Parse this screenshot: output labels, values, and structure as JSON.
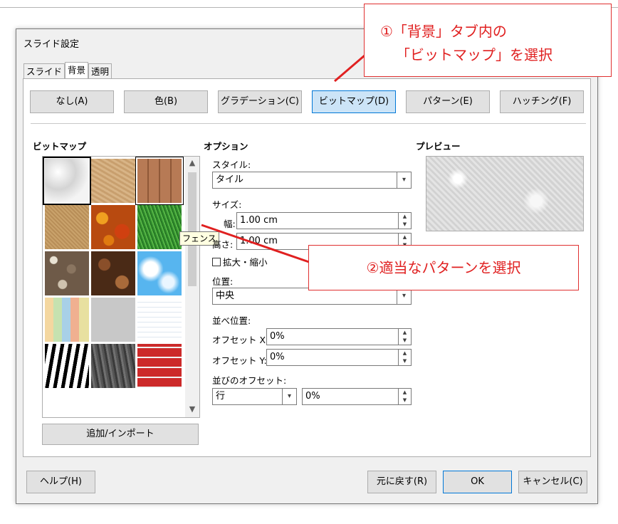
{
  "dialog": {
    "title": "スライド設定"
  },
  "tabs": [
    {
      "label": "スライド"
    },
    {
      "label": "背景"
    },
    {
      "label": "透明"
    }
  ],
  "fill_buttons": [
    {
      "label": "なし(A)"
    },
    {
      "label": "色(B)"
    },
    {
      "label": "グラデーション(C)"
    },
    {
      "label": "ビットマップ(D)"
    },
    {
      "label": "パターン(E)"
    },
    {
      "label": "ハッチング(F)"
    }
  ],
  "selected_fill": "ビットマップ(D)",
  "bitmap": {
    "heading": "ビットマップ",
    "tiles": [
      "painted-white",
      "sand",
      "fence",
      "paper",
      "autumn-leaves",
      "grass",
      "pebbles",
      "coffee-beans",
      "sky",
      "color-stripes",
      "concrete",
      "lines",
      "zebra",
      "bark",
      "brick"
    ],
    "tooltip": "フェンス",
    "add_button": "追加/インポート"
  },
  "options": {
    "heading": "オプション",
    "style_label": "スタイル:",
    "style_value": "タイル",
    "size_label": "サイズ:",
    "width_label": "幅:",
    "width_value": "1.00 cm",
    "height_label": "高さ:",
    "height_value": "1.00 cm",
    "scale_label": "拡大・縮小",
    "position_label": "位置:",
    "position_value": "中央",
    "tiling_label": "並べ位置:",
    "offset_x_label": "オフセット X:",
    "offset_x_value": "0%",
    "offset_y_label": "オフセット Y:",
    "offset_y_value": "0%",
    "tile_offset_label": "並びのオフセット:",
    "tile_offset_type": "行",
    "tile_offset_value": "0%"
  },
  "preview": {
    "heading": "プレビュー"
  },
  "footer": {
    "help": "ヘルプ(H)",
    "reset": "元に戻す(R)",
    "ok": "OK",
    "cancel": "キャンセル(C)"
  },
  "callouts": {
    "first_line1": "①「背景」タブ内の",
    "first_line2": "「ビットマップ」を選択",
    "second": "②適当なパターンを選択"
  },
  "colors": {
    "accent": "#0078d7",
    "annotation": "#e02020"
  }
}
